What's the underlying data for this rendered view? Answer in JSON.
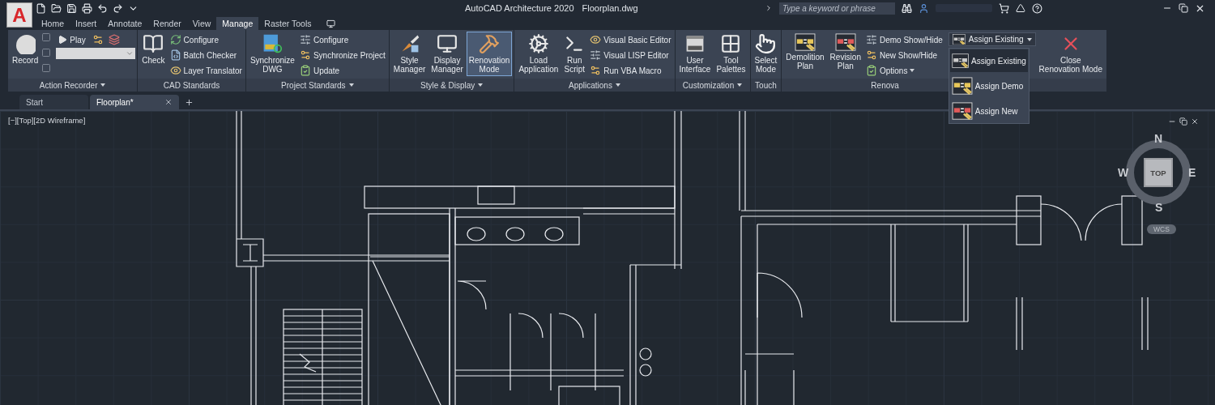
{
  "app_button": {
    "label": "A"
  },
  "title": {
    "app": "AutoCAD Architecture 2020",
    "file": "Floorplan.dwg"
  },
  "search": {
    "placeholder": "Type a keyword or phrase"
  },
  "ribbon_tabs": [
    {
      "label": "Home",
      "selected": false
    },
    {
      "label": "Insert",
      "selected": false
    },
    {
      "label": "Annotate",
      "selected": false
    },
    {
      "label": "Render",
      "selected": false
    },
    {
      "label": "View",
      "selected": false
    },
    {
      "label": "Manage",
      "selected": true
    },
    {
      "label": "Raster Tools",
      "selected": false
    }
  ],
  "panels": [
    {
      "title": "Action Recorder",
      "menu": true,
      "columns": [
        {
          "kind": "large",
          "label": "Record",
          "active": false
        },
        {
          "kind": "recorder",
          "label": "Play"
        }
      ]
    },
    {
      "title": "CAD Standards",
      "menu": false,
      "columns": [
        {
          "kind": "large",
          "label": "Check",
          "active": false
        },
        {
          "kind": "stack",
          "items": [
            {
              "label": "Configure",
              "menu": false
            },
            {
              "label": "Batch Checker",
              "menu": false
            },
            {
              "label": "Layer Translator",
              "menu": false
            }
          ]
        }
      ]
    },
    {
      "title": "Project Standards",
      "menu": true,
      "columns": [
        {
          "kind": "large",
          "label": "Synchronize\nDWG",
          "active": false
        },
        {
          "kind": "stack",
          "items": [
            {
              "label": "Configure",
              "menu": false
            },
            {
              "label": "Synchronize Project",
              "menu": false
            },
            {
              "label": "Update",
              "menu": false
            }
          ]
        }
      ]
    },
    {
      "title": "Style & Display",
      "menu": true,
      "columns": [
        {
          "kind": "large",
          "label": "Style\nManager",
          "active": false
        },
        {
          "kind": "large",
          "label": "Display\nManager",
          "active": false
        },
        {
          "kind": "large",
          "label": "Renovation\nMode",
          "active": true
        }
      ]
    },
    {
      "title": "Applications",
      "menu": true,
      "columns": [
        {
          "kind": "large",
          "label": "Load\nApplication",
          "active": false
        },
        {
          "kind": "large",
          "label": "Run\nScript",
          "active": false
        },
        {
          "kind": "stack",
          "items": [
            {
              "label": "Visual Basic Editor",
              "menu": false
            },
            {
              "label": "Visual LISP Editor",
              "menu": false
            },
            {
              "label": "Run VBA Macro",
              "menu": false
            }
          ]
        }
      ]
    },
    {
      "title": "Customization",
      "menu": true,
      "columns": [
        {
          "kind": "large",
          "label": "User\nInterface",
          "active": false
        },
        {
          "kind": "large",
          "label": "Tool\nPalettes",
          "active": false
        }
      ]
    },
    {
      "title": "Touch",
      "menu": false,
      "columns": [
        {
          "kind": "large",
          "label": "Select\nMode",
          "active": false
        }
      ]
    },
    {
      "title": "Renova",
      "menu": false,
      "columns": [
        {
          "kind": "large",
          "label": "Demolition\nPlan",
          "active": false
        },
        {
          "kind": "large",
          "label": "Revision\nPlan",
          "active": false
        },
        {
          "kind": "stack",
          "items": [
            {
              "label": "Demo Show/Hide",
              "menu": false
            },
            {
              "label": "New Show/Hide",
              "menu": false
            },
            {
              "label": "Options",
              "menu": true
            }
          ]
        },
        {
          "kind": "split",
          "label": "Assign Existing"
        },
        {
          "kind": "large",
          "label": "Close\nRenovation Mode",
          "active": false
        }
      ]
    }
  ],
  "dropdown": {
    "items": [
      {
        "label": "Assign Existing",
        "selected": true
      },
      {
        "label": "Assign Demo",
        "selected": false
      },
      {
        "label": "Assign New",
        "selected": false
      }
    ]
  },
  "doc_tabs": [
    {
      "label": "Start",
      "selected": false,
      "closable": false
    },
    {
      "label": "Floorplan*",
      "selected": true,
      "closable": true
    }
  ],
  "viewport": {
    "label": "[−][Top][2D Wireframe]"
  },
  "viewcube": {
    "north": "N",
    "south": "S",
    "east": "E",
    "west": "W",
    "face": "TOP",
    "ucs": "WCS"
  }
}
